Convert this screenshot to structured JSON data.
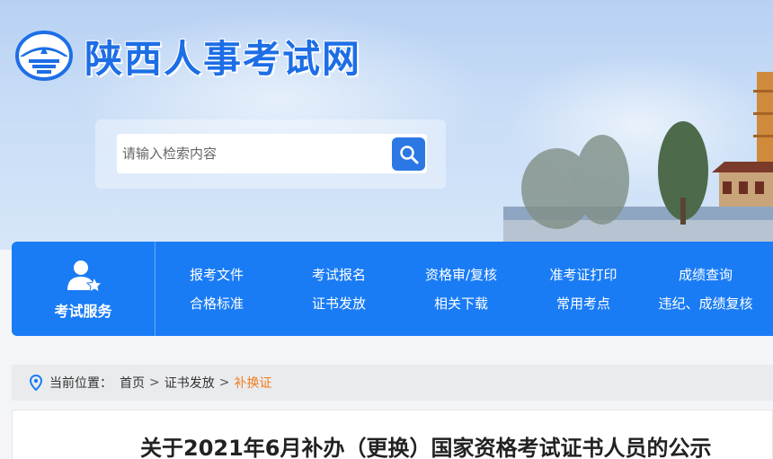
{
  "header": {
    "site_title": "陕西人事考试网",
    "search": {
      "placeholder": "请输入检索内容"
    }
  },
  "nav": {
    "service_label": "考试服务",
    "links": [
      "报考文件",
      "考试报名",
      "资格审/复核",
      "准考证打印",
      "成绩查询",
      "合格标准",
      "证书发放",
      "相关下载",
      "常用考点",
      "违纪、成绩复核"
    ]
  },
  "breadcrumb": {
    "prefix": "当前位置：",
    "items": [
      "首页",
      "证书发放",
      "补换证"
    ],
    "separator": ">"
  },
  "article": {
    "title": "关于2021年6月补办（更换）国家资格考试证书人员的公示"
  },
  "colors": {
    "brand_blue": "#1a7cf5",
    "title_blue": "#1d6ee6",
    "breadcrumb_current": "#f07d1f"
  },
  "icons": {
    "logo": "shaanxi-logo-icon",
    "search": "search-icon",
    "service": "user-star-icon",
    "location": "location-pin-icon"
  }
}
